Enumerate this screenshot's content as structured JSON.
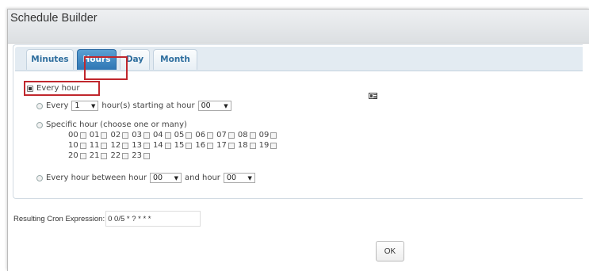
{
  "dialog": {
    "title": "Schedule Builder"
  },
  "tabs": [
    {
      "label": "Minutes",
      "active": false
    },
    {
      "label": "Hours",
      "active": true
    },
    {
      "label": "Day",
      "active": false
    },
    {
      "label": "Month",
      "active": false
    }
  ],
  "options": {
    "every_hour": {
      "label": "Every hour",
      "selected": true
    },
    "every_n": {
      "prefix": "Every",
      "value": "1",
      "middle": "hour(s) starting at hour",
      "start_value": "00"
    },
    "specific": {
      "label": "Specific hour (choose one or many)",
      "rows": [
        [
          "00",
          "01",
          "02",
          "03",
          "04",
          "05",
          "06",
          "07",
          "08",
          "09"
        ],
        [
          "10",
          "11",
          "12",
          "13",
          "14",
          "15",
          "16",
          "17",
          "18",
          "19"
        ],
        [
          "20",
          "21",
          "22",
          "23"
        ]
      ]
    },
    "between": {
      "prefix": "Every hour between hour",
      "from_value": "00",
      "middle": "and hour",
      "to_value": "00"
    }
  },
  "cron": {
    "label": "Resulting Cron Expression:",
    "value": "0 0/5 * ? * * *"
  },
  "ok_label": "OK",
  "icons": {
    "calendar": "calendar-icon",
    "dropdown": "chevron-down-icon"
  },
  "colors": {
    "active_tab": "#3a84c2",
    "tab_text": "#2e6e9e",
    "highlight": "#c0272d"
  }
}
